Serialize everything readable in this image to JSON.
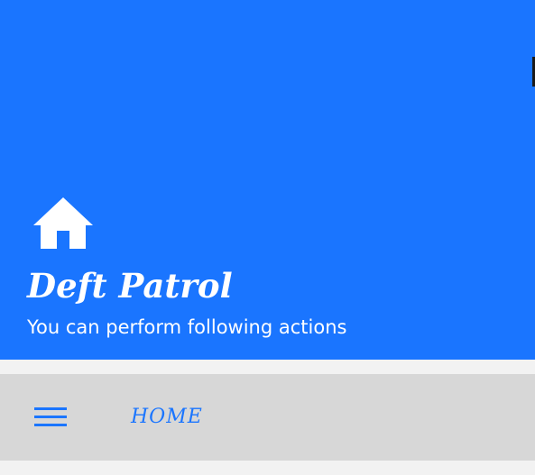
{
  "header": {
    "icon": "home-icon",
    "title": "Deft Patrol",
    "subtitle": "You can perform following actions"
  },
  "navbar": {
    "menu_icon": "hamburger-menu-icon",
    "home_label": "HOME"
  },
  "colors": {
    "primary": "#1a75ff",
    "navbar_bg": "#d7d7d7",
    "page_bg": "#f2f2f2",
    "text_on_primary": "#ffffff"
  }
}
